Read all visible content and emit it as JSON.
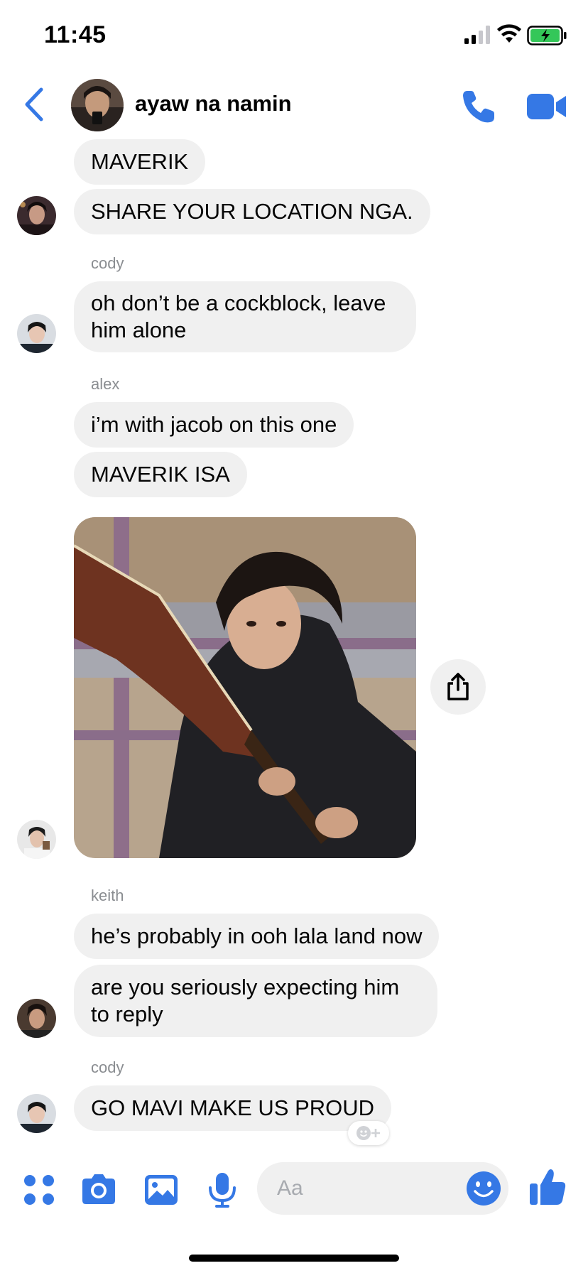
{
  "status_bar": {
    "time": "11:45"
  },
  "header": {
    "title": "ayaw na namin"
  },
  "messages": [
    {
      "text": "MAVERIK"
    },
    {
      "text": "SHARE YOUR LOCATION NGA."
    },
    {
      "sender": "cody",
      "text": "oh don’t be a cockblock, leave him alone"
    },
    {
      "sender": "alex",
      "text": "i’m with jacob on this one"
    },
    {
      "text": "MAVERIK ISA"
    },
    {
      "sender": "keith",
      "text": "he’s probably in ooh lala land now"
    },
    {
      "text": "are you seriously expecting him to reply"
    },
    {
      "sender": "cody",
      "text": "GO MAVI MAKE US PROUD"
    }
  ],
  "composer": {
    "placeholder": "Aa"
  },
  "colors": {
    "accent": "#3578e5",
    "bubble": "#f0f0f0",
    "sender_name": "#8a8d91",
    "battery": "#34c759"
  },
  "icons": [
    "back-chevron-icon",
    "phone-icon",
    "video-camera-icon",
    "share-icon",
    "add-reaction-icon",
    "apps-grid-icon",
    "camera-icon",
    "gallery-icon",
    "microphone-icon",
    "emoji-icon",
    "thumbs-up-icon"
  ]
}
